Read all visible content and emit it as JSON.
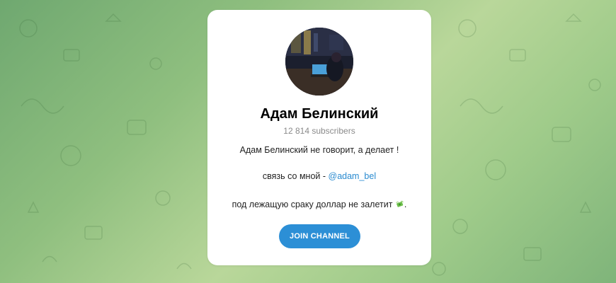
{
  "channel": {
    "title": "Адам Белинский",
    "subscribers": "12 814 subscribers",
    "description": {
      "line1": "Адам Белинский не говорит, а делает !",
      "line2_prefix": "связь со мной - ",
      "line2_link": "@adam_bel",
      "line3_text": "под лежащую сраку доллар не залетит",
      "line3_emoji": "money-with-wings-icon",
      "line3_suffix": "."
    },
    "join_label": "JOIN CHANNEL"
  },
  "colors": {
    "accent": "#2c8fd6",
    "link": "#2a8bd0",
    "card": "#ffffff",
    "background": "#8fbf7f"
  }
}
